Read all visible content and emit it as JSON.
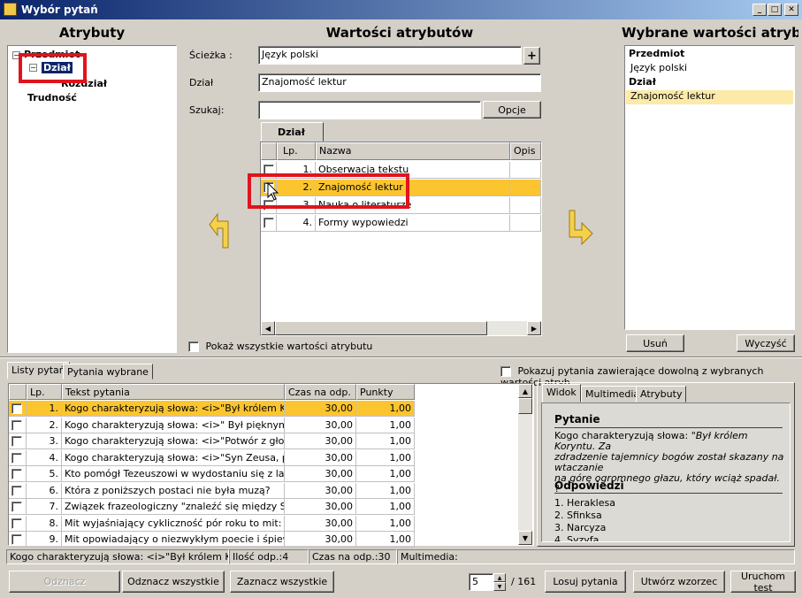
{
  "window": {
    "title": "Wybór pytań"
  },
  "left": {
    "title": "Atrybuty",
    "tree": [
      {
        "label": "Przedmiot"
      },
      {
        "label": "Dział"
      },
      {
        "label": "Rozdział"
      },
      {
        "label": "Trudność"
      }
    ]
  },
  "center": {
    "title": "Wartości atrybutów",
    "path_label": "Ścieżka :",
    "path_value": "Język polski",
    "path_plus": "+",
    "dzial_label": "Dział",
    "dzial_value": "Znajomość lektur",
    "search_label": "Szukaj:",
    "search_value": "",
    "options_button": "Opcje",
    "tab": "Dział",
    "columns": [
      "Lp.",
      "Nazwa",
      "Opis"
    ],
    "rows": [
      {
        "lp": "1.",
        "name": "Obserwacja tekstu"
      },
      {
        "lp": "2.",
        "name": "Znajomość lektur"
      },
      {
        "lp": "3.",
        "name": "Nauka o literaturze"
      },
      {
        "lp": "4.",
        "name": "Formy wypowiedzi"
      }
    ],
    "show_all_label": "Pokaż wszystkie wartości atrybutu"
  },
  "right": {
    "title": "Wybrane wartości atryb.",
    "items": [
      {
        "label": "Przedmiot"
      },
      {
        "label": "Język polski"
      },
      {
        "label": "Dział"
      },
      {
        "label": "Znajomość lektur"
      }
    ],
    "remove_button": "Usuń",
    "clear_button": "Wyczyść"
  },
  "bottom": {
    "tabs": [
      "Listy pytań",
      "Pytania wybrane"
    ],
    "any_value_label": "Pokazuj pytania zawierające dowolną z wybranych wartości atryb.",
    "columns": [
      "Lp.",
      "Tekst pytania",
      "Czas na odp.",
      "Punkty"
    ],
    "rows": [
      {
        "lp": "1.",
        "text": "Kogo charakteryzują słowa: <i>\"Był królem Koryntu",
        "time": "30,00",
        "points": "1,00"
      },
      {
        "lp": "2.",
        "text": "Kogo charakteryzują słowa: <i>\" Był pięknym młodz",
        "time": "30,00",
        "points": "1,00"
      },
      {
        "lp": "3.",
        "text": "Kogo charakteryzują słowa: <i>\"Potwór z głową ko",
        "time": "30,00",
        "points": "1,00"
      },
      {
        "lp": "4.",
        "text": "Kogo charakteryzują słowa: <i>\"Syn Zeusa, prześla",
        "time": "30,00",
        "points": "1,00"
      },
      {
        "lp": "5.",
        "text": "Kto pomógł Tezeuszowi w wydostaniu się z labirynt",
        "time": "30,00",
        "points": "1,00"
      },
      {
        "lp": "6.",
        "text": "Która z poniższych postaci nie była muzą?",
        "time": "30,00",
        "points": "1,00"
      },
      {
        "lp": "7.",
        "text": "Związek frazeologiczny \"znaleźć się między Scyllą a C",
        "time": "30,00",
        "points": "1,00"
      },
      {
        "lp": "8.",
        "text": "Mit wyjaśniający cykliczność pór roku to mit:",
        "time": "30,00",
        "points": "1,00"
      },
      {
        "lp": "9.",
        "text": "Mit opowiadający o niezwykłym poecie i śpiewaku, k",
        "time": "30,00",
        "points": "1,00"
      }
    ],
    "preview_tabs": [
      "Widok",
      "Multimedia",
      "Atrybuty"
    ],
    "question_heading": "Pytanie",
    "question_line1": "Kogo charakteryzują słowa: ",
    "question_line1_italic": "\"Był królem Koryntu. Za",
    "question_line2": "zdradzenie tajemnicy bogów został skazany na",
    "question_line3": "wtaczanie",
    "question_line4": "na górę ogromnego głazu, który wciąż spadał.",
    "question_line4_end": " ?",
    "answers_heading": "Odpowiedzi",
    "answers": [
      "1. Heraklesa",
      "2. Sfinksa",
      "3. Narcyza",
      "4. Syzyfa"
    ]
  },
  "status": {
    "text": "Kogo charakteryzują słowa: <i>\"Był królem Koryntu.",
    "answers": "Ilość odp.:4",
    "time": "Czas na odp.:30",
    "multimedia": "Multimedia:"
  },
  "footer": {
    "unmark": "Odznacz",
    "unmark_all": "Odznacz wszystkie",
    "mark_all": "Zaznacz wszystkie",
    "count_value": "5",
    "total": "/ 161",
    "draw": "Losuj pytania",
    "create_template": "Utwórz wzorzec",
    "run_test": "Uruchom test"
  }
}
